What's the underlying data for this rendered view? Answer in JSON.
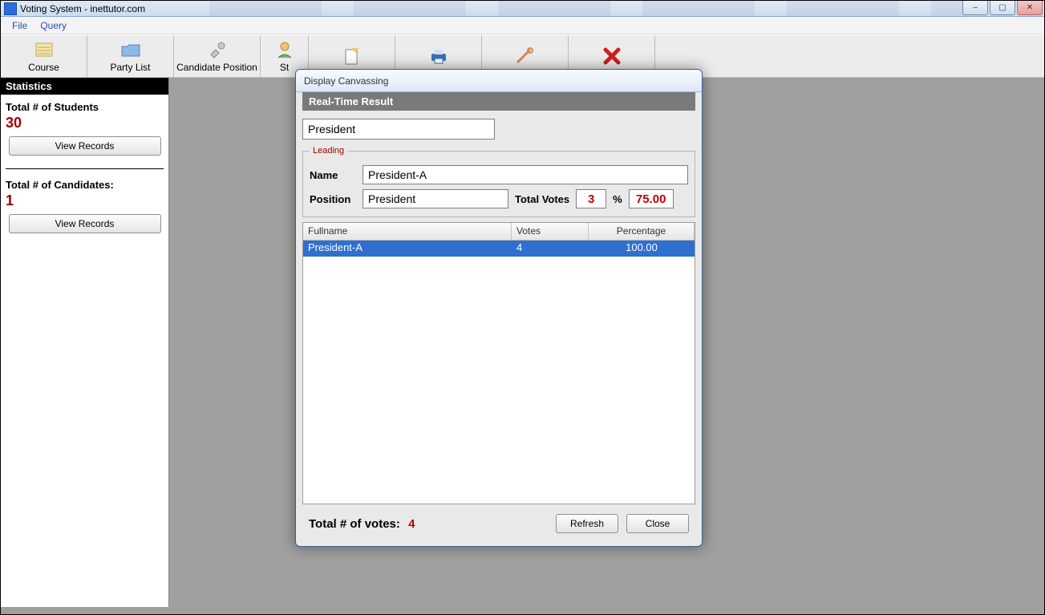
{
  "window": {
    "title": "Voting System - inettutor.com",
    "minimize": "–",
    "maximize": "▢",
    "close": "✕"
  },
  "menu": {
    "file": "File",
    "query": "Query"
  },
  "toolbar": {
    "course": "Course",
    "party": "Party List",
    "candpos": "Candidate Position",
    "st": "St"
  },
  "stats": {
    "header": "Statistics",
    "students_label": "Total # of Students",
    "students_value": "30",
    "view_records": "View Records",
    "candidates_label": "Total # of Candidates:",
    "candidates_value": "1"
  },
  "dialog": {
    "title": "Display Canvassing",
    "section": "Real-Time Result",
    "position_select": "President",
    "leading_legend": "Leading",
    "name_label": "Name",
    "name_value": "President-A",
    "position_label": "Position",
    "position_value": "President",
    "total_votes_label": "Total Votes",
    "total_votes_value": "3",
    "pct_symbol": "%",
    "pct_value": "75.00",
    "grid": {
      "headers": {
        "fullname": "Fullname",
        "votes": "Votes",
        "percentage": "Percentage"
      },
      "rows": [
        {
          "fullname": "President-A",
          "votes": "4",
          "percentage": "100.00"
        }
      ]
    },
    "footer": {
      "total_label": "Total # of votes:",
      "total_value": "4",
      "refresh": "Refresh",
      "close": "Close"
    }
  }
}
